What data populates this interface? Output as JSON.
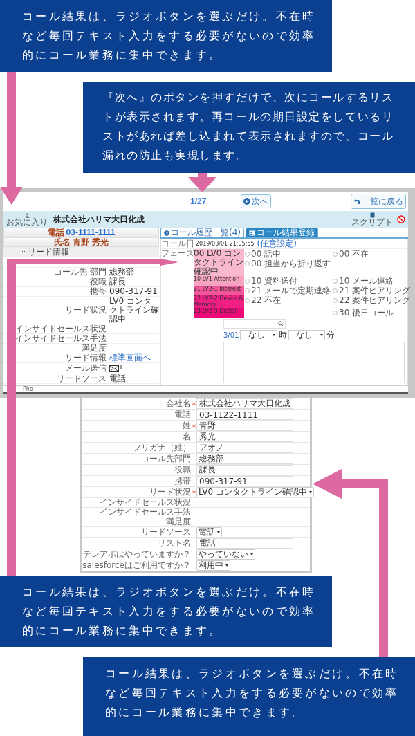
{
  "callouts": [
    {
      "text": "コール結果は、ラジオボタンを選ぶだけ。不在時など毎回テキスト入力をする必要がないので効率的にコール業務に集中できます。"
    },
    {
      "text": "『次へ』のボタンを押すだけで、次にコールするリストが表示されます。再コールの期日設定をしているリストがあれば差し込まれて表示されますので、コール漏れの防止も実現します。"
    },
    {
      "text": "コール結果は、ラジオボタンを選ぶだけ。不在時など毎回テキスト入力をする必要がないので効率的にコール業務に集中できます。"
    },
    {
      "text": "コール結果は、ラジオボタンを選ぶだけ。不在時など毎回テキスト入力をする必要がないので効率的にコール業務に集中できます。"
    }
  ],
  "app": {
    "pager": "1/27",
    "next_button": "次へ",
    "back_button": "一覧に戻る",
    "favorite_label": "お気に入り",
    "company": "株式会社ハリマ大日化成",
    "script_label": "スクリプト",
    "phone_label": "電話",
    "phone": "03-1111-1111",
    "name_label": "氏名",
    "name": "青野 秀光",
    "section": {
      "title": "リード情報",
      "expanded": true
    },
    "lead_fields": [
      {
        "label": "コール先 部門",
        "kind": "text",
        "value": "総務部"
      },
      {
        "label": "役職",
        "kind": "text",
        "value": "課長"
      },
      {
        "label": "携帯",
        "kind": "text",
        "value": "090-317-91"
      },
      {
        "label": "リード状況",
        "kind": "text",
        "value": "LV0 コンタクトライン確認中"
      },
      {
        "label": "インサイドセールス状況",
        "kind": "empty"
      },
      {
        "label": "インサイドセールス手法",
        "kind": "empty"
      },
      {
        "label": "満足度",
        "kind": "empty"
      },
      {
        "label": "リード情報",
        "kind": "link",
        "value": "標準画面へ"
      },
      {
        "label": "メール送信",
        "kind": "mail"
      },
      {
        "label": "リードソース",
        "kind": "text",
        "value": "電話"
      }
    ],
    "footer_text": "Pho",
    "tabs": [
      {
        "label": "コール履歴一覧(4)",
        "selected": false
      },
      {
        "label": "コール結果登録",
        "selected": true
      }
    ],
    "call_date_label": "コール日",
    "call_date": "2019/03/01 21:05:55",
    "call_date_link": "(任意設定)",
    "phase_label": "フェーズ",
    "phases": [
      {
        "label": "00 LV0 コンタクトライン確認中",
        "color": "#f9b9cd",
        "left": [
          {
            "label": "00 話中",
            "selected": false
          },
          {
            "label": "00 担当から折り返す",
            "selected": false
          }
        ],
        "right": [
          {
            "label": "00 不在",
            "selected": false
          }
        ]
      },
      {
        "label": "10 LV1 Attention",
        "color": "#f6a3c0",
        "left": [
          {
            "label": "10 資料送付",
            "selected": false
          }
        ],
        "right": [
          {
            "label": "10 メール連絡",
            "selected": false
          }
        ]
      },
      {
        "label": "21 LV2-1 Interest",
        "color": "#f2559a",
        "left": [
          {
            "label": "21 メールで定期連絡",
            "selected": false
          }
        ],
        "right": [
          {
            "label": "21 案件ヒアリング",
            "selected": false
          }
        ]
      },
      {
        "label": "22 LV2-2 Desire & Memory",
        "color": "#ef1f84",
        "left": [
          {
            "label": "22 不在",
            "selected": false
          }
        ],
        "right": [
          {
            "label": "22 案件ヒアリング",
            "selected": false
          }
        ]
      },
      {
        "label": "23 LV2-3 Decisi",
        "color": "#ec0a78",
        "right": [
          {
            "label": "30 後日コール",
            "selected": false
          }
        ]
      }
    ],
    "date_link": "3/01",
    "hour_select": "--なし--",
    "hour_unit": "時",
    "minute_select": "--なし--",
    "minute_unit": "分"
  },
  "popup": {
    "fields": [
      {
        "label": "会社名",
        "required": true,
        "kind": "input",
        "value": "株式会社ハリマ大日化成"
      },
      {
        "label": "電話",
        "required": false,
        "kind": "input",
        "value": "03-1122-1111"
      },
      {
        "label": "姓",
        "required": true,
        "kind": "input",
        "value": "青野"
      },
      {
        "label": "名",
        "required": false,
        "kind": "input",
        "value": "秀光"
      },
      {
        "label": "フリガナ（姓）",
        "required": false,
        "kind": "input",
        "value": "アオノ"
      },
      {
        "label": "コール先部門",
        "required": false,
        "kind": "input",
        "value": "総務部"
      },
      {
        "label": "役職",
        "required": false,
        "kind": "input",
        "value": "課長"
      },
      {
        "label": "携帯",
        "required": false,
        "kind": "input",
        "value": "090-317-91"
      },
      {
        "label": "リード状況",
        "required": true,
        "kind": "select",
        "value": "LV0 コンタクトライン確認中"
      },
      {
        "label": "インサイドセールス状況",
        "required": false,
        "kind": "empty"
      },
      {
        "label": "インサイドセールス手法",
        "required": false,
        "kind": "empty"
      },
      {
        "label": "満足度",
        "required": false,
        "kind": "empty"
      },
      {
        "label": "リードソース",
        "required": false,
        "kind": "select",
        "value": "電話"
      },
      {
        "label": "リスト名",
        "required": false,
        "kind": "input",
        "value": "電話"
      },
      {
        "label": "テレアポはやっていますか？",
        "required": false,
        "kind": "select",
        "value": "やっていない"
      },
      {
        "label": "salesforceはご利用ですか？",
        "required": false,
        "kind": "select",
        "value": "利用中"
      }
    ]
  }
}
